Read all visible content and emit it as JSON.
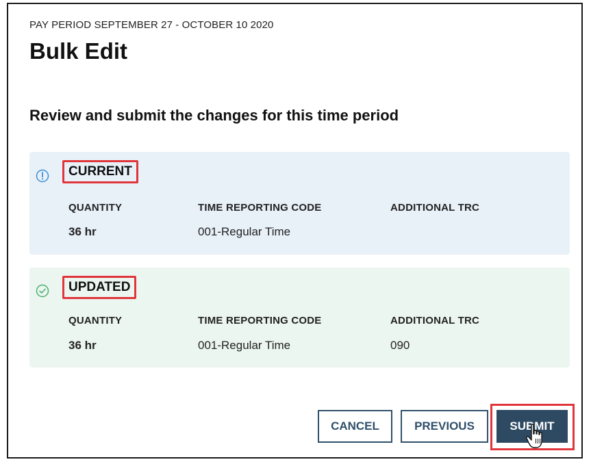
{
  "dialog": {
    "pay_period": "PAY PERIOD SEPTEMBER 27 - OCTOBER 10 2020",
    "title": "Bulk Edit",
    "subtitle": "Review and submit the changes for this time period"
  },
  "current": {
    "status_label": "CURRENT",
    "icon": "info-icon",
    "headers": {
      "quantity": "QUANTITY",
      "trc": "TIME REPORTING CODE",
      "additional_trc": "ADDITIONAL TRC"
    },
    "values": {
      "quantity": "36 hr",
      "trc": "001-Regular Time",
      "additional_trc": ""
    }
  },
  "updated": {
    "status_label": "UPDATED",
    "icon": "check-circle-icon",
    "headers": {
      "quantity": "QUANTITY",
      "trc": "TIME REPORTING CODE",
      "additional_trc": "ADDITIONAL TRC"
    },
    "values": {
      "quantity": "36 hr",
      "trc": "001-Regular Time",
      "additional_trc": "090"
    }
  },
  "buttons": {
    "cancel": "CANCEL",
    "previous": "PREVIOUS",
    "submit": "SUBMIT"
  },
  "colors": {
    "current_bg": "#e8f0f8",
    "updated_bg": "#ecf6f0",
    "primary": "#2e4a63",
    "highlight": "#e0353b",
    "info_icon": "#3b8fd6",
    "check_icon": "#4caf6e"
  }
}
